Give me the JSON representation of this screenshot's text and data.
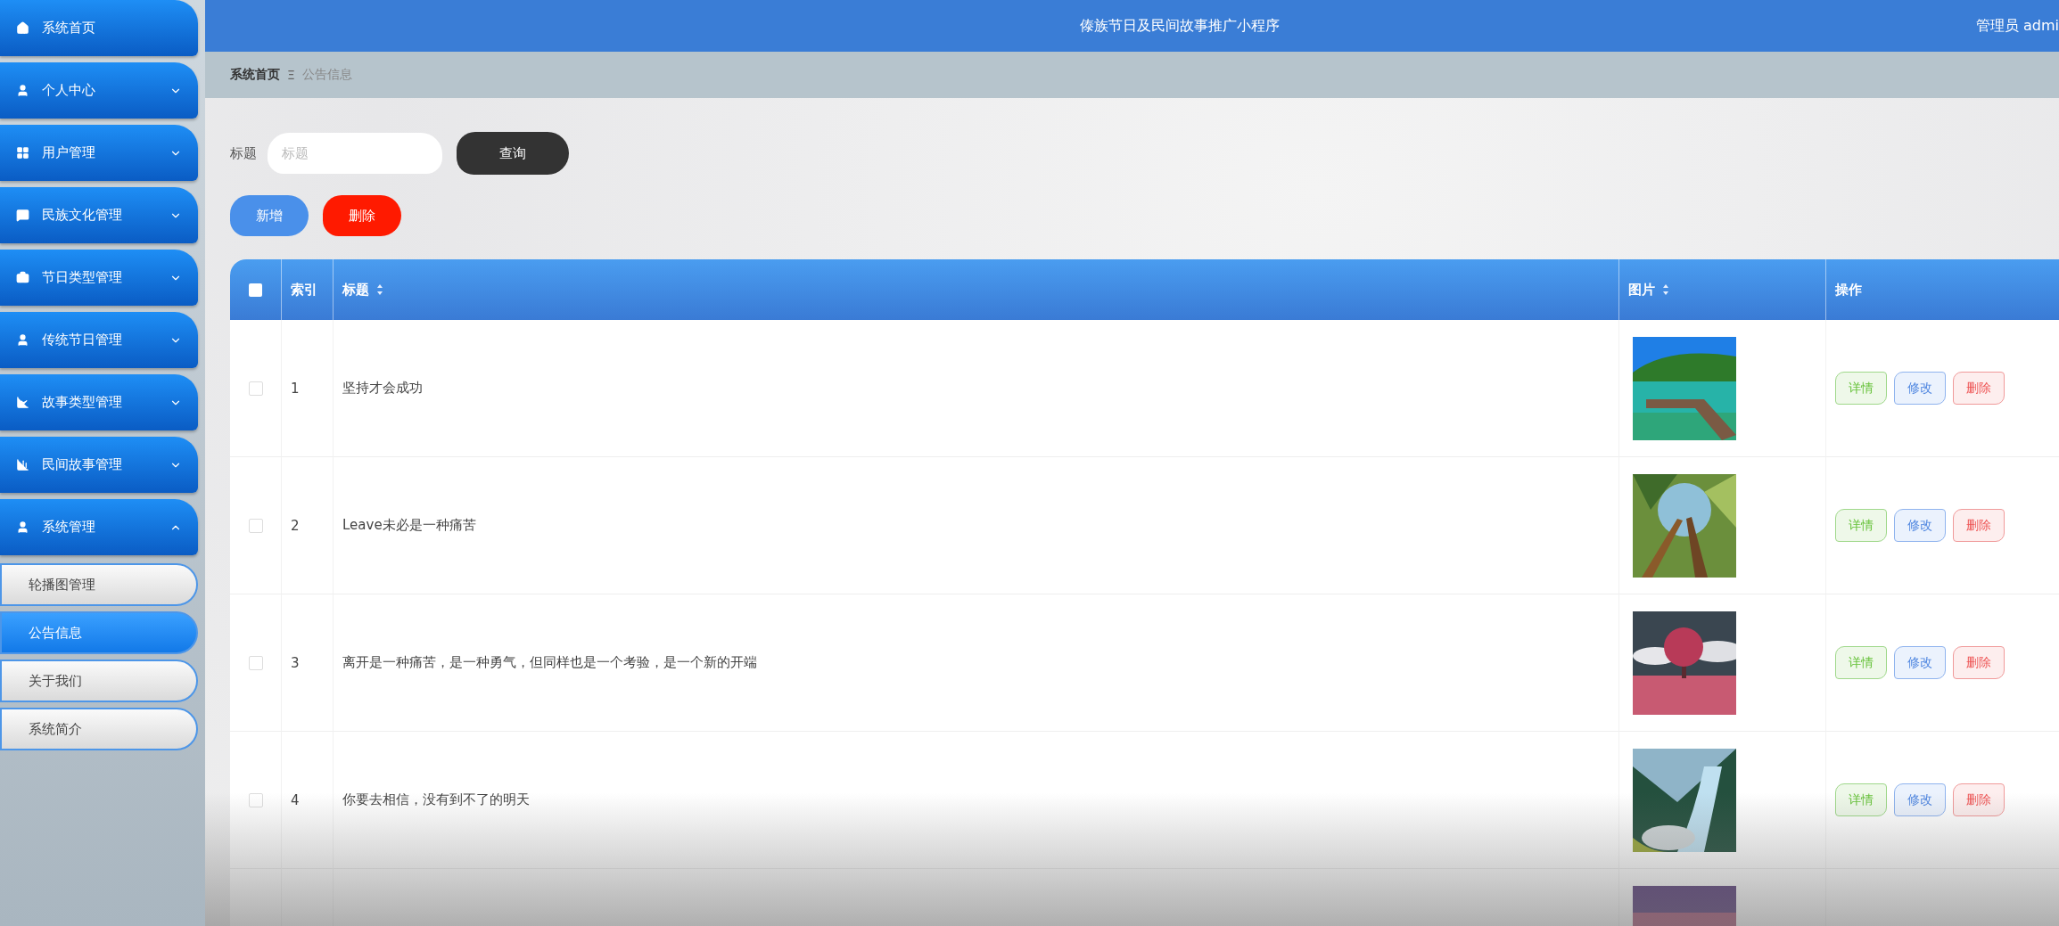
{
  "sidebar": {
    "items": [
      {
        "label": "系统首页",
        "has_chevron": false
      },
      {
        "label": "个人中心",
        "expanded": false,
        "has_chevron": true
      },
      {
        "label": "用户管理",
        "expanded": false,
        "has_chevron": true
      },
      {
        "label": "民族文化管理",
        "expanded": false,
        "has_chevron": true
      },
      {
        "label": "节日类型管理",
        "expanded": false,
        "has_chevron": true
      },
      {
        "label": "传统节日管理",
        "expanded": false,
        "has_chevron": true
      },
      {
        "label": "故事类型管理",
        "expanded": false,
        "has_chevron": true
      },
      {
        "label": "民间故事管理",
        "expanded": false,
        "has_chevron": true
      },
      {
        "label": "系统管理",
        "expanded": true,
        "has_chevron": true,
        "children": [
          {
            "label": "轮播图管理",
            "selected": false
          },
          {
            "label": "公告信息",
            "selected": true
          },
          {
            "label": "关于我们",
            "selected": false
          },
          {
            "label": "系统简介",
            "selected": false
          }
        ]
      }
    ]
  },
  "topbar": {
    "title": "傣族节日及民间故事推广小程序",
    "user": "管理员 admi"
  },
  "breadcrumb": {
    "home": "系统首页",
    "separator": "Ξ",
    "current": "公告信息"
  },
  "search": {
    "label": "标题",
    "placeholder": "标题",
    "button": "查询"
  },
  "actions": [
    {
      "label": "新增",
      "kind": "add"
    },
    {
      "label": "删除",
      "kind": "delete"
    }
  ],
  "table": {
    "header_checked": false,
    "columns": [
      {
        "label": "索引",
        "sortable": false
      },
      {
        "label": "标题",
        "sortable": true
      },
      {
        "label": "图片",
        "sortable": true
      },
      {
        "label": "操作",
        "sortable": false
      }
    ],
    "rows": [
      {
        "checked": false,
        "index": "1",
        "title": "坚持才会成功",
        "picture": {
          "kind": "picture"
        },
        "buttons": [
          {
            "label": "详情",
            "kind": "detail"
          },
          {
            "label": "修改",
            "kind": "edit"
          },
          {
            "label": "删除",
            "kind": "delete"
          }
        ]
      },
      {
        "checked": false,
        "index": "2",
        "title": "Leave未必是一种痛苦",
        "picture": {
          "kind": "picture"
        },
        "buttons": [
          {
            "label": "详情",
            "kind": "detail"
          },
          {
            "label": "修改",
            "kind": "edit"
          },
          {
            "label": "删除",
            "kind": "delete"
          }
        ]
      },
      {
        "checked": false,
        "index": "3",
        "title": "离开是一种痛苦，是一种勇气，但同样也是一个考验，是一个新的开端",
        "picture": {
          "kind": "picture"
        },
        "buttons": [
          {
            "label": "详情",
            "kind": "detail"
          },
          {
            "label": "修改",
            "kind": "edit"
          },
          {
            "label": "删除",
            "kind": "delete"
          }
        ]
      },
      {
        "checked": false,
        "index": "4",
        "title": "你要去相信，没有到不了的明天",
        "picture": {
          "kind": "picture"
        },
        "buttons": [
          {
            "label": "详情",
            "kind": "detail"
          },
          {
            "label": "修改",
            "kind": "edit"
          },
          {
            "label": "删除",
            "kind": "delete"
          }
        ]
      },
      {
        "picture": {
          "kind": "picture"
        }
      }
    ]
  }
}
